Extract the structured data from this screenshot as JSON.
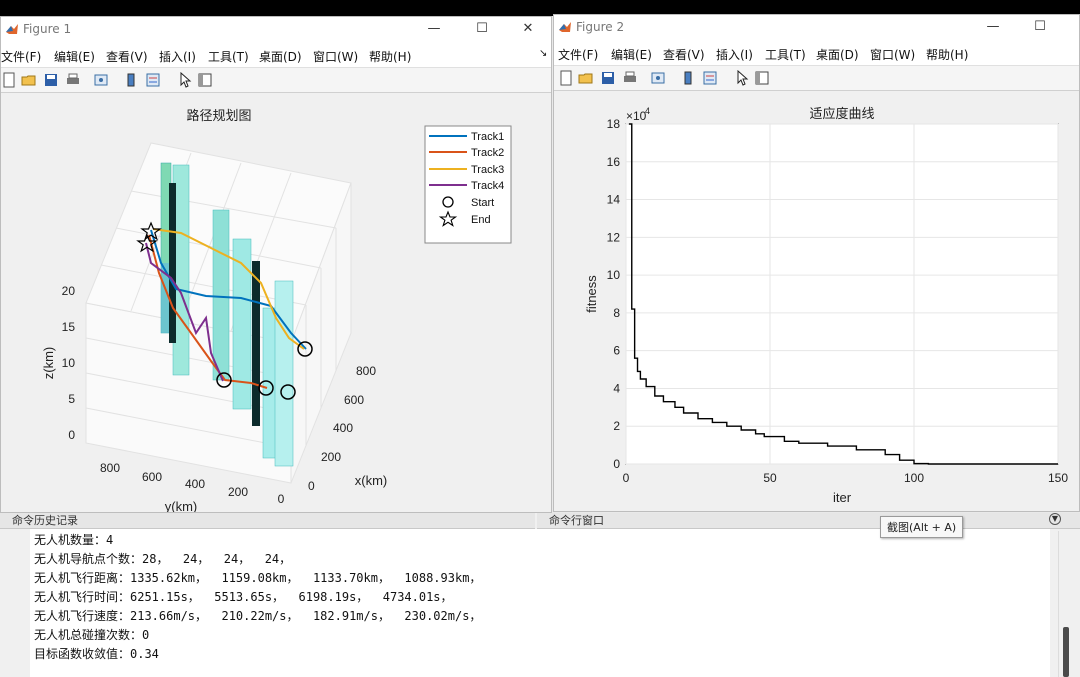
{
  "figure1": {
    "title": "Figure 1",
    "menus": [
      "文件(F)",
      "编辑(E)",
      "查看(V)",
      "插入(I)",
      "工具(T)",
      "桌面(D)",
      "窗口(W)",
      "帮助(H)"
    ],
    "chart_title": "路径规划图",
    "zlabel": "z(km)",
    "ylabel": "y(km)",
    "xlabel": "x(km)",
    "zticks": [
      "0",
      "5",
      "10",
      "15",
      "20"
    ],
    "yticks": [
      "800",
      "600",
      "400",
      "200",
      "0"
    ],
    "xticks": [
      "0",
      "200",
      "400",
      "600",
      "800"
    ],
    "legend": [
      "Track1",
      "Track2",
      "Track3",
      "Track4",
      "Start",
      "End"
    ],
    "colors": {
      "track1": "#0072bd",
      "track2": "#d95319",
      "track3": "#edb120",
      "track4": "#7e2f8e"
    }
  },
  "figure2": {
    "title": "Figure 2",
    "menus": [
      "文件(F)",
      "编辑(E)",
      "查看(V)",
      "插入(I)",
      "工具(T)",
      "桌面(D)",
      "窗口(W)",
      "帮助(H)"
    ],
    "chart_title": "适应度曲线",
    "exponent_base": "×10",
    "exponent": "4"
  },
  "chart_data": {
    "type": "line",
    "title": "适应度曲线",
    "xlabel": "iter",
    "ylabel": "fitness",
    "xlim": [
      0,
      150
    ],
    "ylim": [
      0,
      18
    ],
    "y_scale_note": "×10^4",
    "xticks": [
      "0",
      "50",
      "100",
      "150"
    ],
    "yticks": [
      "0",
      "2",
      "4",
      "6",
      "8",
      "10",
      "12",
      "14",
      "16",
      "18"
    ],
    "grid": true,
    "series": [
      {
        "x": [
          1,
          2,
          3,
          4,
          5,
          7,
          10,
          13,
          17,
          20,
          25,
          30,
          35,
          40,
          45,
          48,
          55,
          60,
          70,
          80,
          90,
          95,
          100,
          105,
          110,
          120,
          130,
          140,
          150
        ],
        "y": [
          18,
          8.2,
          5.6,
          4.9,
          4.5,
          4.1,
          3.6,
          3.3,
          3.0,
          2.7,
          2.4,
          2.2,
          2.0,
          1.8,
          1.6,
          1.45,
          1.2,
          1.1,
          0.95,
          0.75,
          0.5,
          0.2,
          0.02,
          0.0,
          0.0,
          0.0,
          0.0,
          0.0,
          0.0
        ]
      }
    ]
  },
  "command_history": {
    "title": "命令历史记录"
  },
  "command_window": {
    "title": "命令行窗口",
    "lines": [
      "无人机数量：4",
      "无人机导航点个数：28，  24，  24，  24，",
      "无人机飞行距离：1335.62km，  1159.08km，  1133.70km，  1088.93km，",
      "无人机飞行时间：6251.15s，  5513.65s，  6198.19s，  4734.01s，",
      "无人机飞行速度：213.66m/s，  210.22m/s，  182.91m/s，  230.02m/s，",
      "无人机总碰撞次数：0",
      "目标函数收敛值：0.34"
    ]
  },
  "tooltip": "截图(Alt + A)"
}
